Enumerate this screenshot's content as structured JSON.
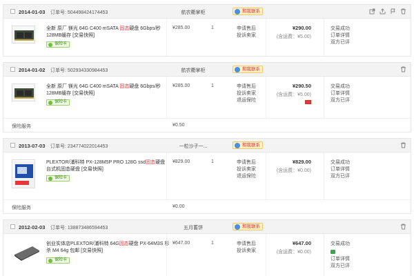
{
  "labels": {
    "order_no": "订单号:",
    "insurance": "保险卡",
    "contact": "和我联系",
    "service_fee": "保险服务"
  },
  "orders": [
    {
      "date": "2014-01-03",
      "order_no": "504498424174453",
      "shop": "航农衢掌柜",
      "product_name_a": "全新 原厂 镁光 64G C400 mSATA ",
      "product_name_hl": "固态",
      "product_name_b": "硬盘 6Gbps/秒 128MB缓存 [交易快照]",
      "unit_price": "¥285.00",
      "qty": "1",
      "services": [
        "申请售后",
        "投诉卖家"
      ],
      "total": "¥290.00",
      "shipping": "(含运费：¥5.00)",
      "status": [
        "交易成功",
        "订单详情",
        "双方已评"
      ]
    },
    {
      "date": "2014-01-02",
      "order_no": "502934330984453",
      "shop": "航农衢掌柜",
      "product_name_a": "全新 原厂 镁光 64G C400 mSATA ",
      "product_name_hl": "固态",
      "product_name_b": "硬盘 6Gbps/秒 128MB缓存 [交易快照]",
      "unit_price": "¥285.00",
      "qty": "1",
      "services": [
        "申请售后",
        "投诉卖家",
        "退运保险"
      ],
      "total": "¥290.50",
      "shipping": "(含运费：¥5.00)",
      "status": [
        "交易成功",
        "订单详情",
        "双方已评"
      ],
      "service_fee": "¥0.50"
    },
    {
      "date": "2013-07-03",
      "order_no": "234774022014453",
      "shop": "一粒沙子一...",
      "product_name_a": "PLEXTOR/浦科特 PX-128M5P PRO 128G ssd",
      "product_name_hl": "固态",
      "product_name_b": "硬盘 台式机固态硬盘 [交易快照]",
      "unit_price": "¥829.00",
      "qty": "1",
      "services": [
        "申请售后",
        "投诉卖家",
        "退运保险"
      ],
      "total": "¥829.00",
      "shipping": "(含运费：¥0.00)",
      "status": [
        "交易成功",
        "订单详情",
        "双方已评"
      ],
      "service_fee": "¥0.00"
    },
    {
      "date": "2012-02-03",
      "order_no": "138873486594453",
      "shop": "五月蓄饼",
      "product_name_a": "创业实体店PLEXTOR/浦科特 64G",
      "product_name_hl": "固态",
      "product_name_b": "硬盘 PX-64M3S 杉杀 M4 64g 包邮 [交易快照]",
      "unit_price": "¥647.00",
      "qty": "1",
      "services": [
        "申请售后",
        "投诉卖家"
      ],
      "total": "¥647.00",
      "shipping": "(含运费：¥0.00)",
      "status": [
        "交易成功",
        "订单详情",
        "双方已评"
      ]
    }
  ],
  "colors": {
    "accent": "#e4393c",
    "header_bg": "#f3f3f3",
    "border": "#e6e6e6"
  }
}
